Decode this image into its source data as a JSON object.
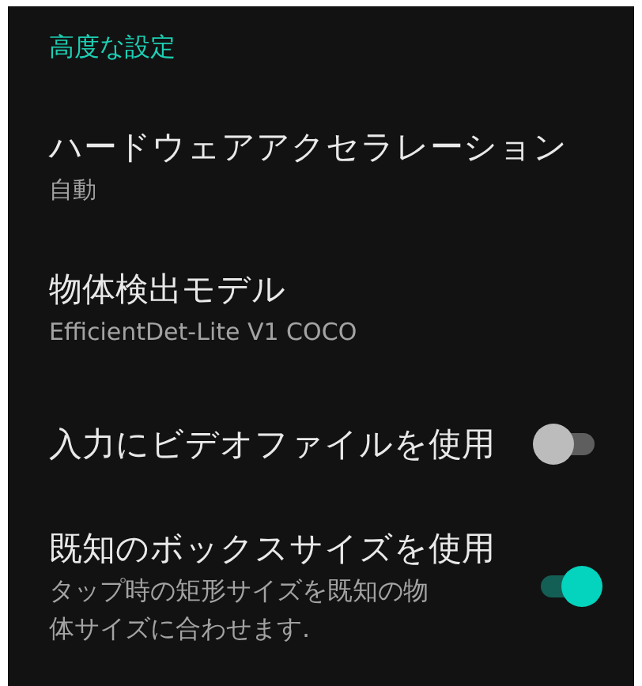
{
  "section": {
    "title": "高度な設定"
  },
  "items": [
    {
      "kind": "value",
      "title": "ハードウェアアクセラレーション",
      "summary": "自動"
    },
    {
      "kind": "value",
      "title": "物体検出モデル",
      "summary": "EfficientDet-Lite V1 COCO"
    },
    {
      "kind": "switch",
      "title": "入力にビデオファイルを使用",
      "on": false
    },
    {
      "kind": "switch",
      "title": "既知のボックスサイズを使用",
      "summary": "タップ時の矩形サイズを既知の物体サイズに合わせます.",
      "on": true
    }
  ]
}
